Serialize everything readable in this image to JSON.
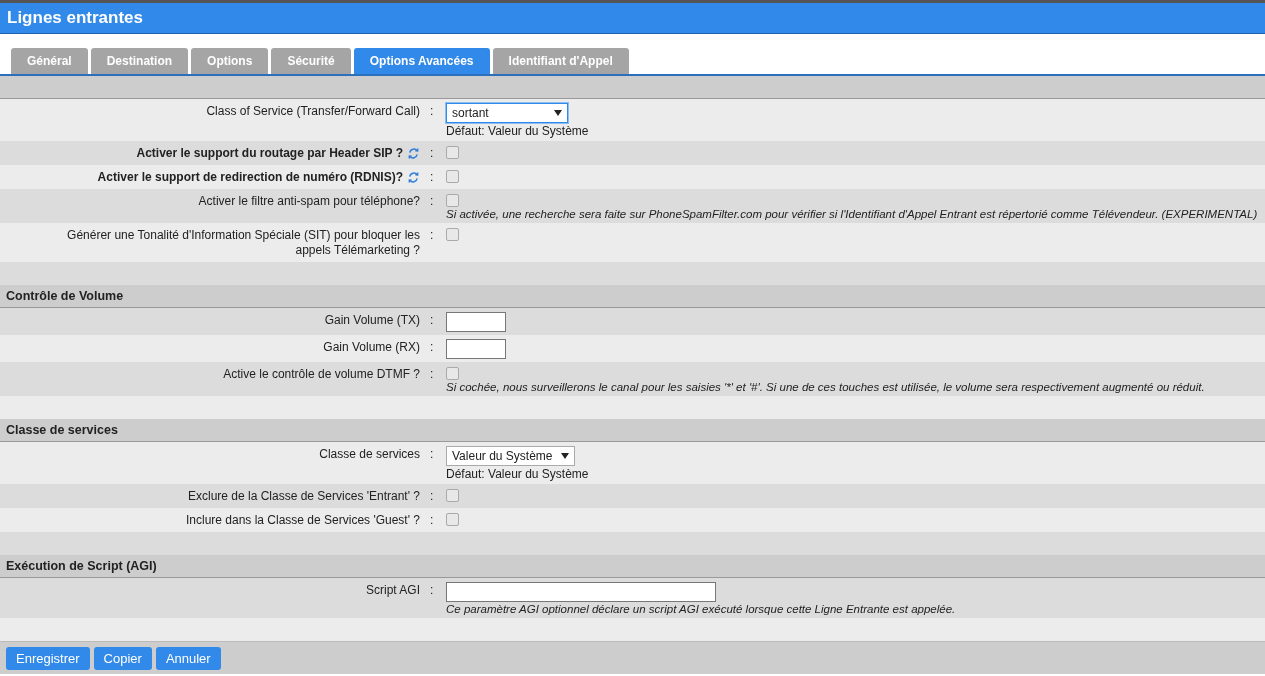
{
  "window": {
    "title": "Lignes entrantes"
  },
  "tabs": [
    {
      "label": "Général",
      "selected": false
    },
    {
      "label": "Destination",
      "selected": false
    },
    {
      "label": "Options",
      "selected": false
    },
    {
      "label": "Sécurité",
      "selected": false
    },
    {
      "label": "Options Avancées",
      "selected": true
    },
    {
      "label": "Identifiant d'Appel",
      "selected": false
    }
  ],
  "sections": [
    {
      "rows": [
        {
          "kind": "select",
          "label": "Class of Service (Transfer/Forward Call)",
          "bold": false,
          "colon": ":",
          "value": "sortant",
          "note": "Défaut: Valeur du Système"
        },
        {
          "kind": "checkbox",
          "label": "Activer le support du routage par Header SIP ?",
          "bold": true,
          "help_icon": true,
          "colon": ":",
          "checked": false
        },
        {
          "kind": "checkbox",
          "label": "Activer le support de redirection de numéro (RDNIS)?",
          "bold": true,
          "help_icon": true,
          "colon": ":",
          "checked": false
        },
        {
          "kind": "checkbox",
          "label": "Activer le filtre anti-spam pour téléphone?",
          "bold": false,
          "colon": ":",
          "checked": false,
          "note": "Si activée, une recherche sera faite sur PhoneSpamFilter.com pour vérifier si l'Identifiant d'Appel Entrant est répertorié comme Télévendeur. (EXPERIMENTAL)"
        },
        {
          "kind": "checkbox",
          "label": "Générer une Tonalité d'Information Spéciale (SIT) pour bloquer les appels Télémarketing ?",
          "bold": false,
          "colon": ":",
          "checked": false
        }
      ]
    },
    {
      "title": "Contrôle de Volume",
      "rows": [
        {
          "kind": "number",
          "label": "Gain Volume (TX)",
          "bold": false,
          "colon": ":"
        },
        {
          "kind": "number",
          "label": "Gain Volume (RX)",
          "bold": false,
          "colon": ":"
        },
        {
          "kind": "checkbox",
          "label": "Active le contrôle de volume DTMF ?",
          "bold": false,
          "colon": ":",
          "checked": false,
          "note": "Si cochée, nous surveillerons le canal pour les saisies '*' et '#'. Si une de ces touches est utilisée, le volume sera respectivement augmenté ou réduit."
        }
      ]
    },
    {
      "title": "Classe de services",
      "rows": [
        {
          "kind": "select",
          "label": "Classe de services",
          "bold": false,
          "colon": ":",
          "value": "Valeur du Système",
          "note": "Défaut: Valeur du Système"
        },
        {
          "kind": "checkbox",
          "label": "Exclure de la Classe de Services 'Entrant' ?",
          "bold": false,
          "colon": ":",
          "checked": false
        },
        {
          "kind": "checkbox",
          "label": "Inclure dans la Classe de Services 'Guest' ?",
          "bold": false,
          "colon": ":",
          "checked": false
        }
      ]
    },
    {
      "title": "Exécution de Script (AGI)",
      "rows": [
        {
          "kind": "text",
          "label": "Script AGI",
          "bold": false,
          "colon": ":",
          "note": "Ce paramètre AGI optionnel déclare un script AGI exécuté lorsque cette Ligne Entrante est appelée."
        }
      ]
    }
  ],
  "buttons": [
    "Enregistrer",
    "Copier",
    "Annuler"
  ]
}
